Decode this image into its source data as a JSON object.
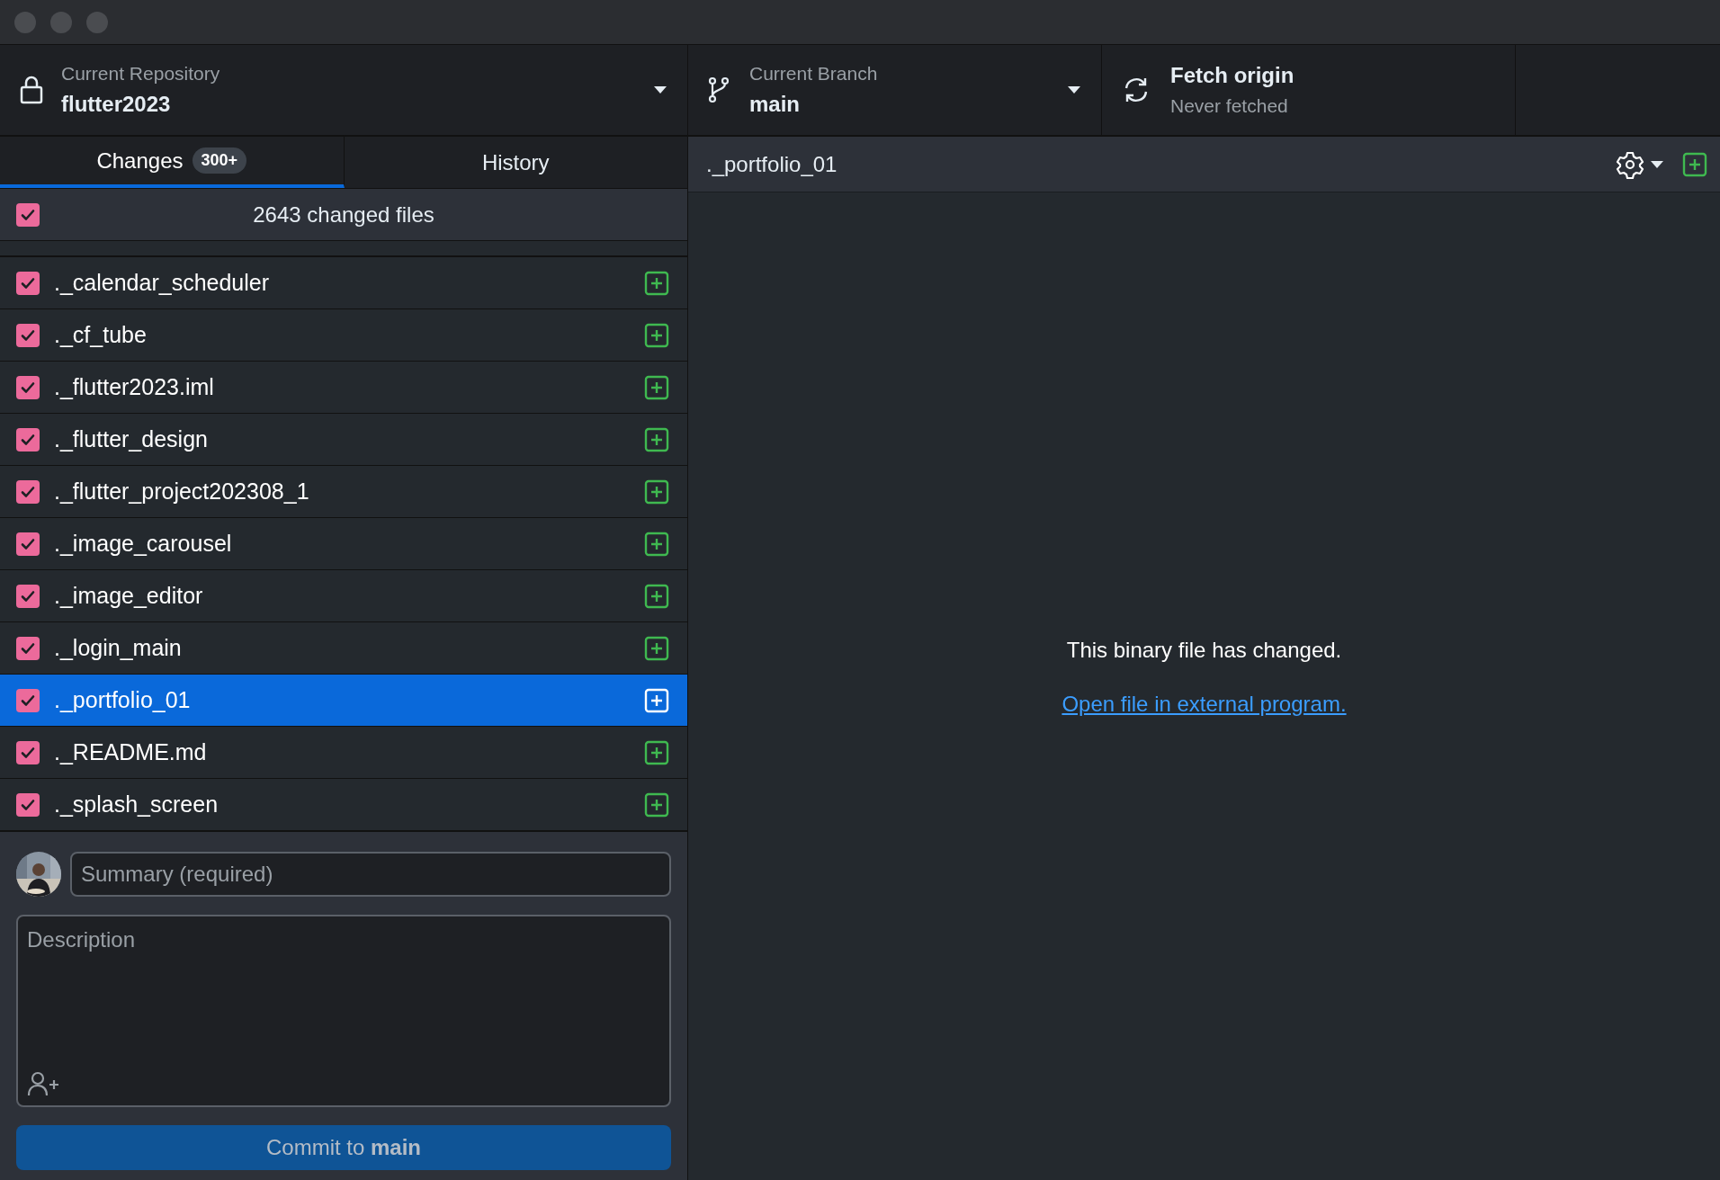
{
  "toolbar": {
    "repository": {
      "label": "Current Repository",
      "value": "flutter2023"
    },
    "branch": {
      "label": "Current Branch",
      "value": "main"
    },
    "fetch": {
      "label": "Fetch origin",
      "status": "Never fetched"
    }
  },
  "tabs": [
    {
      "label": "Changes",
      "badge": "300+",
      "selected": true
    },
    {
      "label": "History",
      "selected": false
    }
  ],
  "changes_header": {
    "text": "2643 changed files",
    "checked": true
  },
  "files": [
    {
      "name": "._calendar_scheduler",
      "checked": true,
      "selected": false
    },
    {
      "name": "._cf_tube",
      "checked": true,
      "selected": false
    },
    {
      "name": "._flutter2023.iml",
      "checked": true,
      "selected": false
    },
    {
      "name": "._flutter_design",
      "checked": true,
      "selected": false
    },
    {
      "name": "._flutter_project202308_1",
      "checked": true,
      "selected": false
    },
    {
      "name": "._image_carousel",
      "checked": true,
      "selected": false
    },
    {
      "name": "._image_editor",
      "checked": true,
      "selected": false
    },
    {
      "name": "._login_main",
      "checked": true,
      "selected": false
    },
    {
      "name": "._portfolio_01",
      "checked": true,
      "selected": true
    },
    {
      "name": "._README.md",
      "checked": true,
      "selected": false
    },
    {
      "name": "._splash_screen",
      "checked": true,
      "selected": false
    }
  ],
  "commit": {
    "summary_placeholder": "Summary (required)",
    "description_placeholder": "Description",
    "button": "Commit to **main**"
  },
  "diff": {
    "file": "._portfolio_01",
    "message": "This binary file has changed.",
    "link": "Open file in external program."
  }
}
